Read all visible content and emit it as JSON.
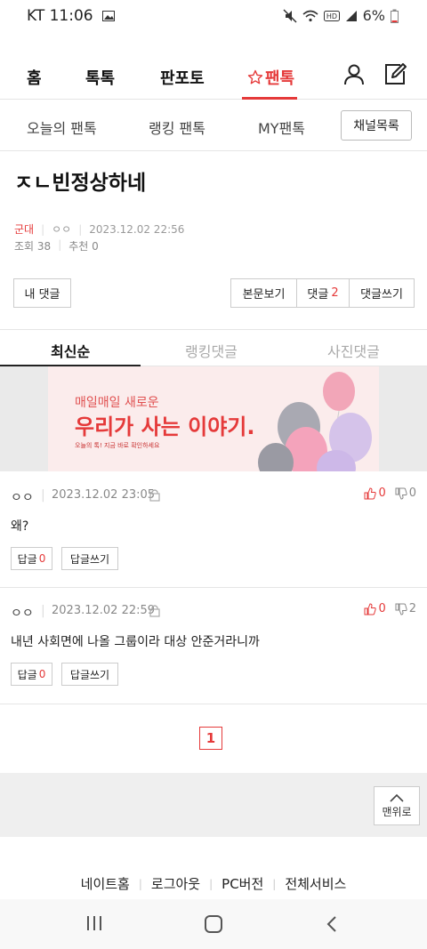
{
  "status_bar": {
    "carrier_time": "KT 11:06",
    "battery": "6%"
  },
  "top_tabs": [
    {
      "label": "홈"
    },
    {
      "label": "톡톡"
    },
    {
      "label": "판포토"
    },
    {
      "label": "팬톡"
    }
  ],
  "sub_tabs": [
    {
      "label": "오늘의 팬톡"
    },
    {
      "label": "랭킹 팬톡"
    },
    {
      "label": "MY팬톡"
    }
  ],
  "channel_button": "채널목록",
  "post": {
    "title": "ㅈㄴ빈정상하네",
    "category": "군대",
    "author": "ㅇㅇ",
    "datetime": "2023.12.02 22:56",
    "views_label": "조회",
    "views": "38",
    "recommend_label": "추천",
    "recommend": "0"
  },
  "buttons": {
    "my_comments": "내 댓글",
    "view_post": "본문보기",
    "comments_label": "댓글",
    "comments_count": "2",
    "write_comment": "댓글쓰기"
  },
  "comment_tabs": [
    {
      "label": "최신순"
    },
    {
      "label": "랭킹댓글"
    },
    {
      "label": "사진댓글"
    }
  ],
  "banner": {
    "line1": "매일매일 새로운",
    "line2": "우리가 사는 이야기.",
    "line3": "오늘의 톡! 지금 바로 확인하세요"
  },
  "comments": [
    {
      "author": "ㅇㅇ",
      "datetime": "2023.12.02 23:05",
      "up": "0",
      "down": "0",
      "body": "왜?",
      "reply_label": "답글",
      "reply_count": "0",
      "write_reply": "답글쓰기"
    },
    {
      "author": "ㅇㅇ",
      "datetime": "2023.12.02 22:59",
      "up": "0",
      "down": "2",
      "body": "내년 사회면에 나올 그룹이라 대상 안준거라니까",
      "reply_label": "답글",
      "reply_count": "0",
      "write_reply": "답글쓰기"
    }
  ],
  "pagination": {
    "current": "1"
  },
  "to_top": "맨위로",
  "footer_links": [
    {
      "label": "네이트홈"
    },
    {
      "label": "로그아웃"
    },
    {
      "label": "PC버전"
    },
    {
      "label": "전체서비스"
    }
  ],
  "colors": {
    "accent": "#e53a3a"
  }
}
